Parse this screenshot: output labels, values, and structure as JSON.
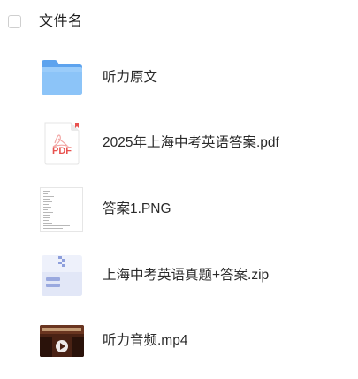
{
  "header": {
    "column_label": "文件名"
  },
  "files": [
    {
      "name": "听力原文",
      "icon": "folder-icon",
      "color": "#6aaef5"
    },
    {
      "name": "2025年上海中考英语答案.pdf",
      "icon": "pdf-file-icon",
      "color": "#e8524f"
    },
    {
      "name": "答案1.PNG",
      "icon": "image-thumbnail-icon"
    },
    {
      "name": "上海中考英语真题+答案.zip",
      "icon": "zip-file-icon",
      "color": "#7c8fd6"
    },
    {
      "name": "听力音频.mp4",
      "icon": "video-thumbnail-icon",
      "color": "#5b2a1a"
    }
  ]
}
